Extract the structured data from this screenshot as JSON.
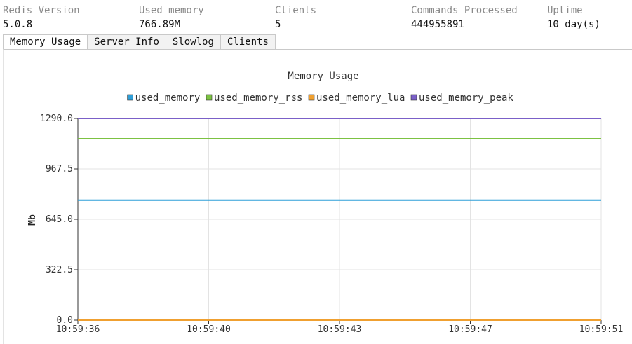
{
  "stats": [
    {
      "label": "Redis Version",
      "value": "5.0.8"
    },
    {
      "label": "Used memory",
      "value": "766.89M"
    },
    {
      "label": "Clients",
      "value": "5"
    },
    {
      "label": "Commands Processed",
      "value": "444955891"
    },
    {
      "label": "Uptime",
      "value": "10 day(s)"
    }
  ],
  "tabs": [
    {
      "label": "Memory Usage",
      "active": true
    },
    {
      "label": "Server Info",
      "active": false
    },
    {
      "label": "Slowlog",
      "active": false
    },
    {
      "label": "Clients",
      "active": false
    }
  ],
  "chart_data": {
    "type": "line",
    "title": "Memory Usage",
    "ylabel": "Mb",
    "xlabel": "",
    "ylim": [
      0,
      1290
    ],
    "yticks": [
      "1290.0",
      "967.5",
      "645.0",
      "322.5",
      "0.0"
    ],
    "x": [
      "10:59:36",
      "10:59:40",
      "10:59:43",
      "10:59:47",
      "10:59:51"
    ],
    "legend_position": "top-center",
    "grid": true,
    "series": [
      {
        "name": "used_memory",
        "color": "#2f9fd8",
        "values": [
          767,
          767,
          767,
          767,
          767
        ]
      },
      {
        "name": "used_memory_rss",
        "color": "#7cc242",
        "values": [
          1160,
          1160,
          1160,
          1160,
          1160
        ]
      },
      {
        "name": "used_memory_lua",
        "color": "#f0a030",
        "values": [
          0,
          0,
          0,
          0,
          0
        ]
      },
      {
        "name": "used_memory_peak",
        "color": "#7b60c8",
        "values": [
          1290,
          1290,
          1290,
          1290,
          1290
        ]
      }
    ]
  }
}
